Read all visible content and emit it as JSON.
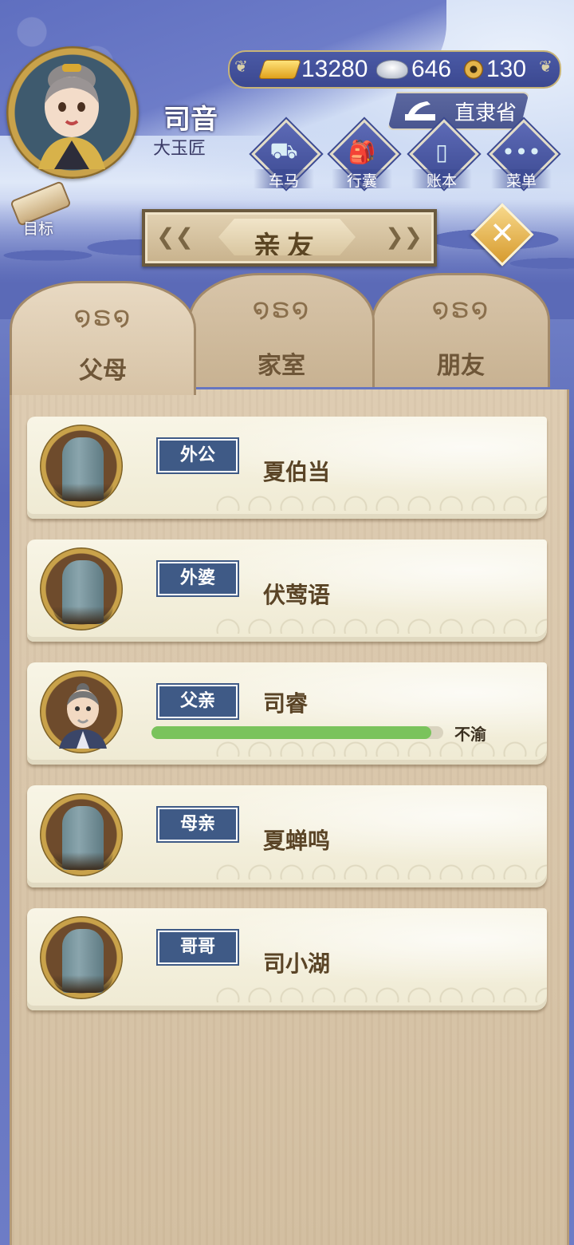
{
  "player": {
    "name": "司音",
    "title": "大玉匠"
  },
  "currency": {
    "gold": "13280",
    "silver": "646",
    "copper": "130"
  },
  "location": "直隶省",
  "menu": [
    {
      "label": "车马",
      "icon": "carriage-icon"
    },
    {
      "label": "行囊",
      "icon": "bag-icon"
    },
    {
      "label": "账本",
      "icon": "ledger-icon"
    },
    {
      "label": "菜单",
      "icon": "more-icon"
    }
  ],
  "goal_label": "目标",
  "panel_title": "亲友",
  "tabs": [
    {
      "label": "父母",
      "active": true
    },
    {
      "label": "家室",
      "active": false
    },
    {
      "label": "朋友",
      "active": false
    }
  ],
  "relatives": [
    {
      "role": "外公",
      "name": "夏伯当",
      "deceased": true
    },
    {
      "role": "外婆",
      "name": "伏莺语",
      "deceased": true
    },
    {
      "role": "父亲",
      "name": "司睿",
      "deceased": false,
      "health": 0.96,
      "status": "不渝"
    },
    {
      "role": "母亲",
      "name": "夏蝉鸣",
      "deceased": true
    },
    {
      "role": "哥哥",
      "name": "司小湖",
      "deceased": true
    }
  ],
  "colors": {
    "tag_blue": "#3f5a86",
    "health_green": "#7ac35c",
    "wood": "#d7c3a6"
  }
}
